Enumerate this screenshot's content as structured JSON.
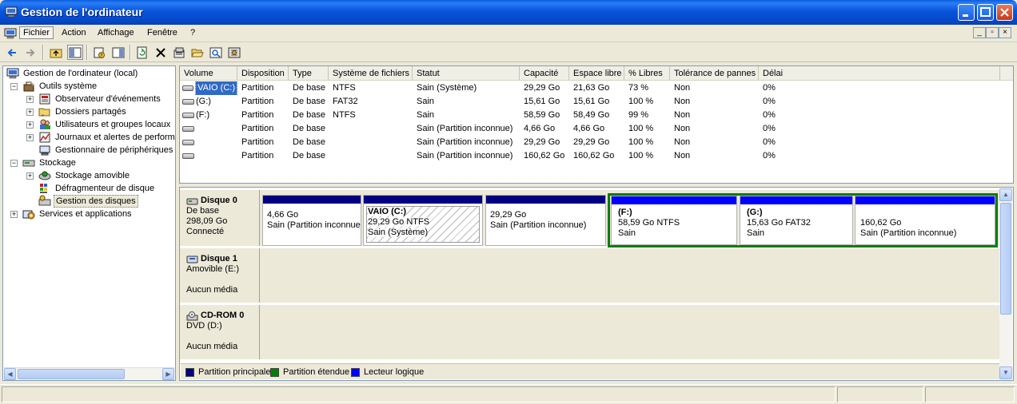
{
  "window": {
    "title": "Gestion de l'ordinateur"
  },
  "menu": [
    "Fichier",
    "Action",
    "Affichage",
    "Fenêtre",
    "?"
  ],
  "toolbar_icons": [
    "back-arrow-icon",
    "forward-arrow-icon",
    "up-folder-icon",
    "show-hide-tree-icon",
    "properties-icon",
    "help-icon",
    "refresh-icon",
    "delete-icon",
    "properties-sheet-icon",
    "open-folder-icon",
    "search-icon",
    "settings-icon"
  ],
  "tree": {
    "root": "Gestion de l'ordinateur (local)",
    "items": [
      {
        "label": "Outils système"
      },
      {
        "label": "Observateur d'événements"
      },
      {
        "label": "Dossiers partagés"
      },
      {
        "label": "Utilisateurs et groupes locaux"
      },
      {
        "label": "Journaux et alertes de perform"
      },
      {
        "label": "Gestionnaire de périphériques"
      },
      {
        "label": "Stockage"
      },
      {
        "label": "Stockage amovible"
      },
      {
        "label": "Défragmenteur de disque"
      },
      {
        "label": "Gestion des disques"
      },
      {
        "label": "Services et applications"
      }
    ]
  },
  "volumes": {
    "columns": [
      "Volume",
      "Disposition",
      "Type",
      "Système de fichiers",
      "Statut",
      "Capacité",
      "Espace libre",
      "% Libres",
      "Tolérance de pannes",
      "Délai"
    ],
    "rows": [
      [
        "VAIO (C:)",
        "Partition",
        "De base",
        "NTFS",
        "Sain (Système)",
        "29,29 Go",
        "21,63 Go",
        "73 %",
        "Non",
        "0%"
      ],
      [
        "(G:)",
        "Partition",
        "De base",
        "FAT32",
        "Sain",
        "15,61 Go",
        "15,61 Go",
        "100 %",
        "Non",
        "0%"
      ],
      [
        "(F:)",
        "Partition",
        "De base",
        "NTFS",
        "Sain",
        "58,59 Go",
        "58,49 Go",
        "99 %",
        "Non",
        "0%"
      ],
      [
        "",
        "Partition",
        "De base",
        "",
        "Sain (Partition inconnue)",
        "4,66 Go",
        "4,66 Go",
        "100 %",
        "Non",
        "0%"
      ],
      [
        "",
        "Partition",
        "De base",
        "",
        "Sain (Partition inconnue)",
        "29,29 Go",
        "29,29 Go",
        "100 %",
        "Non",
        "0%"
      ],
      [
        "",
        "Partition",
        "De base",
        "",
        "Sain (Partition inconnue)",
        "160,62 Go",
        "160,62 Go",
        "100 %",
        "Non",
        "0%"
      ]
    ]
  },
  "disks": [
    {
      "name": "Disque 0",
      "line1": "De base",
      "line2": "298,09 Go",
      "line3": "Connecté",
      "partitions": [
        {
          "name": "",
          "size": "4,66 Go",
          "status": "Sain (Partition inconnue)"
        },
        {
          "name": "VAIO  (C:)",
          "size": "29,29 Go NTFS",
          "status": "Sain (Système)"
        },
        {
          "name": "",
          "size": "29,29 Go",
          "status": "Sain (Partition inconnue)"
        },
        {
          "name": "(F:)",
          "size": "58,59 Go NTFS",
          "status": "Sain"
        },
        {
          "name": "(G:)",
          "size": "15,63 Go FAT32",
          "status": "Sain"
        },
        {
          "name": "",
          "size": "160,62 Go",
          "status": "Sain (Partition inconnue)"
        }
      ]
    },
    {
      "name": "Disque 1",
      "line1": "Amovible (E:)",
      "line2": "",
      "line3": "Aucun média"
    },
    {
      "name": "CD-ROM 0",
      "line1": "DVD (D:)",
      "line2": "",
      "line3": "Aucun média"
    }
  ],
  "legend": [
    {
      "label": "Partition principale",
      "color": "#000080"
    },
    {
      "label": "Partition étendue",
      "color": "#008000"
    },
    {
      "label": "Lecteur logique",
      "color": "#0000FF"
    }
  ]
}
